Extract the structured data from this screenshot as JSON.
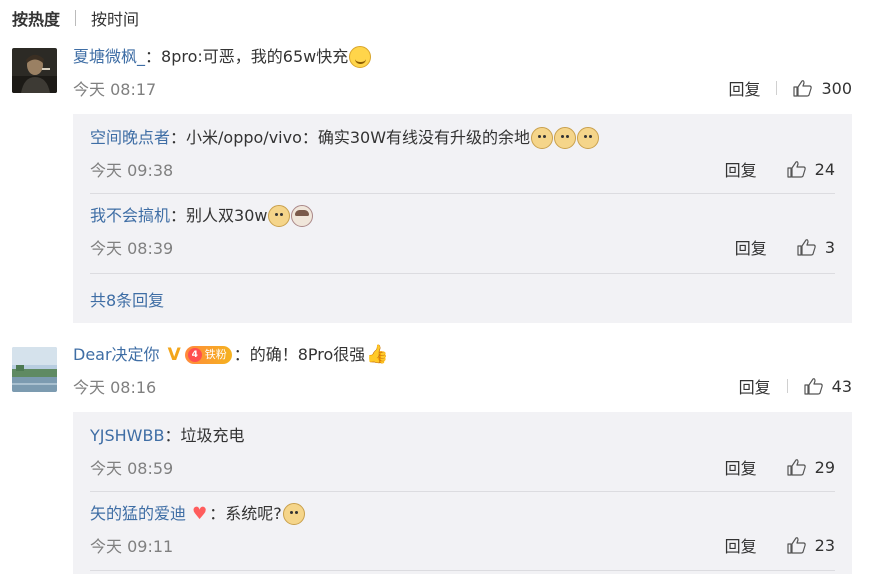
{
  "sort": {
    "hot": "按热度",
    "time": "按时间"
  },
  "comments": [
    {
      "user": "夏塘微枫_",
      "text": "：8pro:可恶，我的65w快充",
      "time": "今天 08:17",
      "reply_label": "回复",
      "likes": "300",
      "emojis": [
        "smirk-face-icon"
      ],
      "replies": [
        {
          "user": "空间晚点者",
          "text": "：小米/oppo/vivo：确实30W有线没有升级的余地",
          "time": "今天 09:38",
          "reply_label": "回复",
          "likes": "24",
          "emojis": [
            "doge-icon",
            "doge-icon",
            "doge-icon"
          ]
        },
        {
          "user": "我不会搞机",
          "text": "：别人双30w",
          "time": "今天 08:39",
          "reply_label": "回复",
          "likes": "3",
          "emojis": [
            "doge-icon",
            "cat-icon"
          ]
        }
      ],
      "more": "共8条回复"
    },
    {
      "user": "Dear决定你",
      "fan_badge": "铁粉",
      "fan_level": "4",
      "text": "：的确！8Pro很强",
      "time": "今天 08:16",
      "reply_label": "回复",
      "likes": "43",
      "emojis": [
        "thumbs-up-icon"
      ],
      "replies": [
        {
          "user": "YJSHWBB",
          "text": "：垃圾充电",
          "time": "今天 08:59",
          "reply_label": "回复",
          "likes": "29"
        },
        {
          "user": "矢的猛的爱迪",
          "text": "：系统呢?",
          "time": "今天 09:11",
          "reply_label": "回复",
          "likes": "23",
          "emojis": [
            "doge-icon"
          ]
        }
      ]
    }
  ],
  "colors": {
    "link": "#3f6ea5",
    "meta": "#808080",
    "reply_bg": "#f2f2f5",
    "vip": "#f3a61b"
  }
}
